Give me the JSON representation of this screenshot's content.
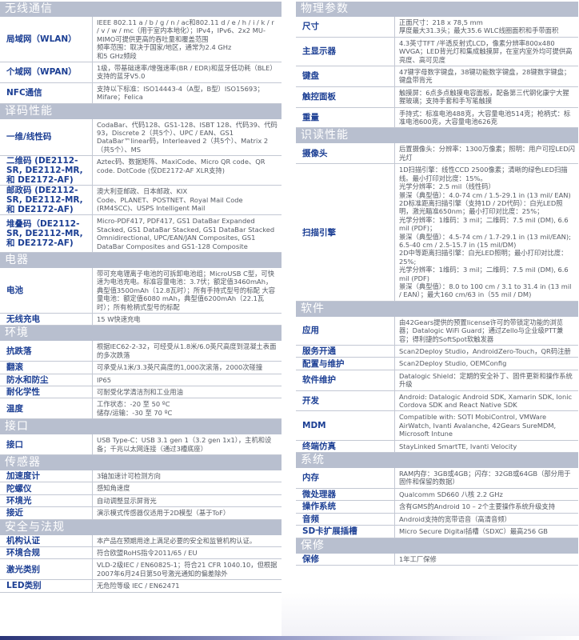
{
  "colors": {
    "section_header_bg": "#b8bfcf",
    "label_text": "#1c3f94",
    "value_text": "#555a63",
    "accent_bar": "#2a3477"
  },
  "left_column": [
    {
      "title": "无线通信",
      "rows": [
        {
          "label": "局域网（WLAN）",
          "value": "IEEE 802.11 a / b / g / n / ac和802.11 d / e / h / i / k / r / v / w / mc（用于室内本地化）；IPv4，IPv6、2x2 MU-MIMO可提供更高的吞吐量和覆盖范围\n频率范围：取决于国家/地区，通常为2.4 GHz\n和5 GHz频段"
        },
        {
          "label": "个域网（WPAN）",
          "value": "1级，带基础速率/增强速率(BR / EDR)和蓝牙低功耗（BLE）支持的蓝牙V5.0"
        },
        {
          "label": "NFC通信",
          "value": "支持以下标准：ISO14443-4（A型，B型）ISO15693；Mifare；Felica"
        }
      ]
    },
    {
      "title": "译码性能",
      "rows": [
        {
          "label": "一维/线性码",
          "value": "CodaBar、代码128、GS1-128、ISBT 128、代码39、代码93，Discrete 2（共5个）、UPC / EAN、GS1 DataBar™linear码，Interleaved 2（共5个）、Matrix 2（共5个）、MS"
        },
        {
          "label": "二维码 (DE2112-SR, DE2112-MR, 和 DE2172-AF)",
          "value": "Aztec码、数据矩阵、MaxiCode、Micro QR code、QR code. DotCode (仅DE2172-AF XLR支持)"
        },
        {
          "label": "邮政码 (DE2112-SR, DE2112-MR, 和 DE2172-AF)",
          "value": "澳大利亚邮政、日本邮政、KIX\nCode、PLANET、POSTNET、Royal Mail Code (RM4SCC)、USPS Intelligent Mail"
        },
        {
          "label": "堆叠码（DE2112-SR, DE2112-MR, 和 DE2172-AF)",
          "value": "Micro-PDF417, PDF417, GS1 DataBar Expanded Stacked, GS1 DataBar Stacked, GS1 DataBar Stacked Omnidirectional, UPC/EAN/JAN Composites, GS1 DataBar Composites and GS1-128 Composite"
        }
      ]
    },
    {
      "title": "电器",
      "rows": [
        {
          "label": "电池",
          "value": "带可充电锂离子电池的可拆卸电池组；MicroUSB C型，可快速为电池充电。标准容量电池：3.7伏；额定值3460mAh，典型值3500mAh（12.8瓦时）；所有手持式型号的标配 大容量电池：额定值6080 mAh，典型值6200mAh（22.1瓦时）；所有枪柄式型号的标配"
        },
        {
          "label": "无线充电",
          "value": "15 W快速充电"
        }
      ]
    },
    {
      "title": "环境",
      "rows": [
        {
          "label": "抗跌落",
          "value": "根据IEC62-2-32，可经受从1.8米/6.0英尺高度到混凝土表面的多次跌落"
        },
        {
          "label": "翻滚",
          "value": "可承受从1米/3.3英尺高度的1,000次滚落，2000次碰撞"
        },
        {
          "label": "防水和防尘",
          "value": "IP65"
        },
        {
          "label": "耐化学性",
          "value": "可耐受化学清洁剂和工业用油"
        },
        {
          "label": "温度",
          "value": "工作状态：-20 至 50 ºC\n储存/运输：-30 至 70 ºC"
        }
      ]
    },
    {
      "title": "接口",
      "rows": [
        {
          "label": "接口",
          "value": "USB Type-C：USB 3.1 gen 1（3.2 gen 1x1），主机和设备；千兆以太网连接（通过3槽底座）"
        }
      ]
    },
    {
      "title": "传感器",
      "rows": [
        {
          "label": "加速度计",
          "value": "3轴加速计可检测方向"
        },
        {
          "label": "陀螺仪",
          "value": "感知角速度"
        },
        {
          "label": "环境光",
          "value": "自动调整显示屏背光"
        },
        {
          "label": "接近",
          "value": "演示模式传感器仅适用于2D模型（基于ToF）"
        }
      ]
    },
    {
      "title": "安全与法规",
      "rows": [
        {
          "label": "机构认证",
          "value": "本产品在预期用途上满足必要的安全和监管机构认证。"
        },
        {
          "label": "环境合规",
          "value": "符合欧盟RoHS指令2011/65 / EU"
        },
        {
          "label": "激光类别",
          "value": "VLD-2级IEC / EN60825-1；符合21 CFR 1040.10，但根据2007年6月24日第50号激光通知的偏差除外"
        },
        {
          "label": "LED类别",
          "value": "无危险等级 IEC / EN62471"
        }
      ]
    }
  ],
  "right_column": [
    {
      "title": "物理参数",
      "rows": [
        {
          "label": "尺寸",
          "value": "正面尺寸：218 x 78,5 mm\n厚度最大31.3头；最大35.6 WLC线圈面积和手带面积"
        },
        {
          "label": "主显示器",
          "value": "4.3英寸TFT /半透反射式LCD，像素分辨率800x480 WVGA；LED背光灯和集成触摸屏，在室内室外均可提供高亮度、高可见度"
        },
        {
          "label": "键盘",
          "value": "47键字母数字键盘，38键功能数字键盘，28键数字键盘；键盘带背光"
        },
        {
          "label": "触控面板",
          "value": "触摸屏：6点多点触摸电容面板，配备第三代钢化康宁大猩猩玻璃；支持手套和手写笔触摸"
        },
        {
          "label": "重量",
          "value": "手持式：标准电池488克，大容量电池514克；枪柄式：标准电池600克，大容量电池626克"
        }
      ]
    },
    {
      "title": "识读性能",
      "rows": [
        {
          "label": "摄像头",
          "value": "后置摄像头：分辨率：1300万像素；照明：用户可控LED闪光灯"
        },
        {
          "label": "扫描引擎",
          "value": "1D扫描引擎：线性CCD 2500像素；清晰的绿色LED扫描线。最小打印对比度：15%。\n光学分辨率：2.5 mil（线性码）\n景深（典型值）：4.0-74 cm / 1.5-29.1 in (13 mil/ EAN)\n2D标准距离扫描引擎（支持1D / 2D代码）：白光LED照明，激光瞄准650nm；最小打印对比度：25%；\n光学分辨率：1维码：3 mil；二维码：7.5 mil (DM), 6.6 mil (PDF)；\n景深（典型值）：4.5-74 cm / 1.7-29.1 in (13 mil/EAN); 6.5-40 cm / 2.5-15.7 in (15 mil/DM)\n2D中等距离扫描引擎：白光LED照明；最小打印对比度：25%;\n光学分辨率：1维码：3 mil；二维码：7.5 mil (DM), 6.6 mil (PDF)\n景深（典型值）：8.0 to 100 cm / 3.1 to 31.4 in (13 mil / EAN）；最大160 cm/63 in（55 mil / DM)"
        }
      ]
    },
    {
      "title": "软件",
      "rows": [
        {
          "label": "应用",
          "value": "由42Gears提供的预置license许可的带锁定功能的浏览器；Datalogic WiFi Guard；通过Zello与企业级PTT兼容；得利捷的SoftSpot软触发器"
        },
        {
          "label": "服务开通",
          "value": "Scan2Deploy Studio，AndroidZero-Touch，QR码注册"
        },
        {
          "label": "配置与维护",
          "value": "Scan2Deploy Studio, OEMConfig"
        },
        {
          "label": "软件维护",
          "value": "Datalogic Shield：定期的安全补丁、固件更新和操作系统升级"
        },
        {
          "label": "开发",
          "value": "Android: Datalogic Android SDK, Xamarin SDK, Ionic Cordova SDK and React Native SDK"
        },
        {
          "label": "MDM",
          "value": "Compatible with: SOTI MobiControl, VMWare AirWatch, Ivanti Avalanche, 42Gears SureMDM, Microsoft Intune"
        },
        {
          "label": "终端仿真",
          "value": "StayLinked SmartTE, Ivanti Velocity"
        }
      ]
    },
    {
      "title": "系统",
      "rows": [
        {
          "label": "内存",
          "value": "RAM内存：3GB或4GB；闪存：32GB或64GB（部分用于固件和保留的数据）"
        },
        {
          "label": "微处理器",
          "value": "Qualcomm SD660 八核 2.2 GHz"
        },
        {
          "label": "操作系统",
          "value": "含有GMS的Android 10 – 2个主要操作系统升级支持"
        },
        {
          "label": "音频",
          "value": "Android支持的宽带语音（高清音频）"
        },
        {
          "label": "SD卡扩展插槽",
          "value": "Micro Secure Digital插槽（SDXC）最高256 GB"
        }
      ]
    },
    {
      "title": "保修",
      "rows": [
        {
          "label": "保修",
          "value": "1年工厂保修"
        }
      ]
    }
  ]
}
